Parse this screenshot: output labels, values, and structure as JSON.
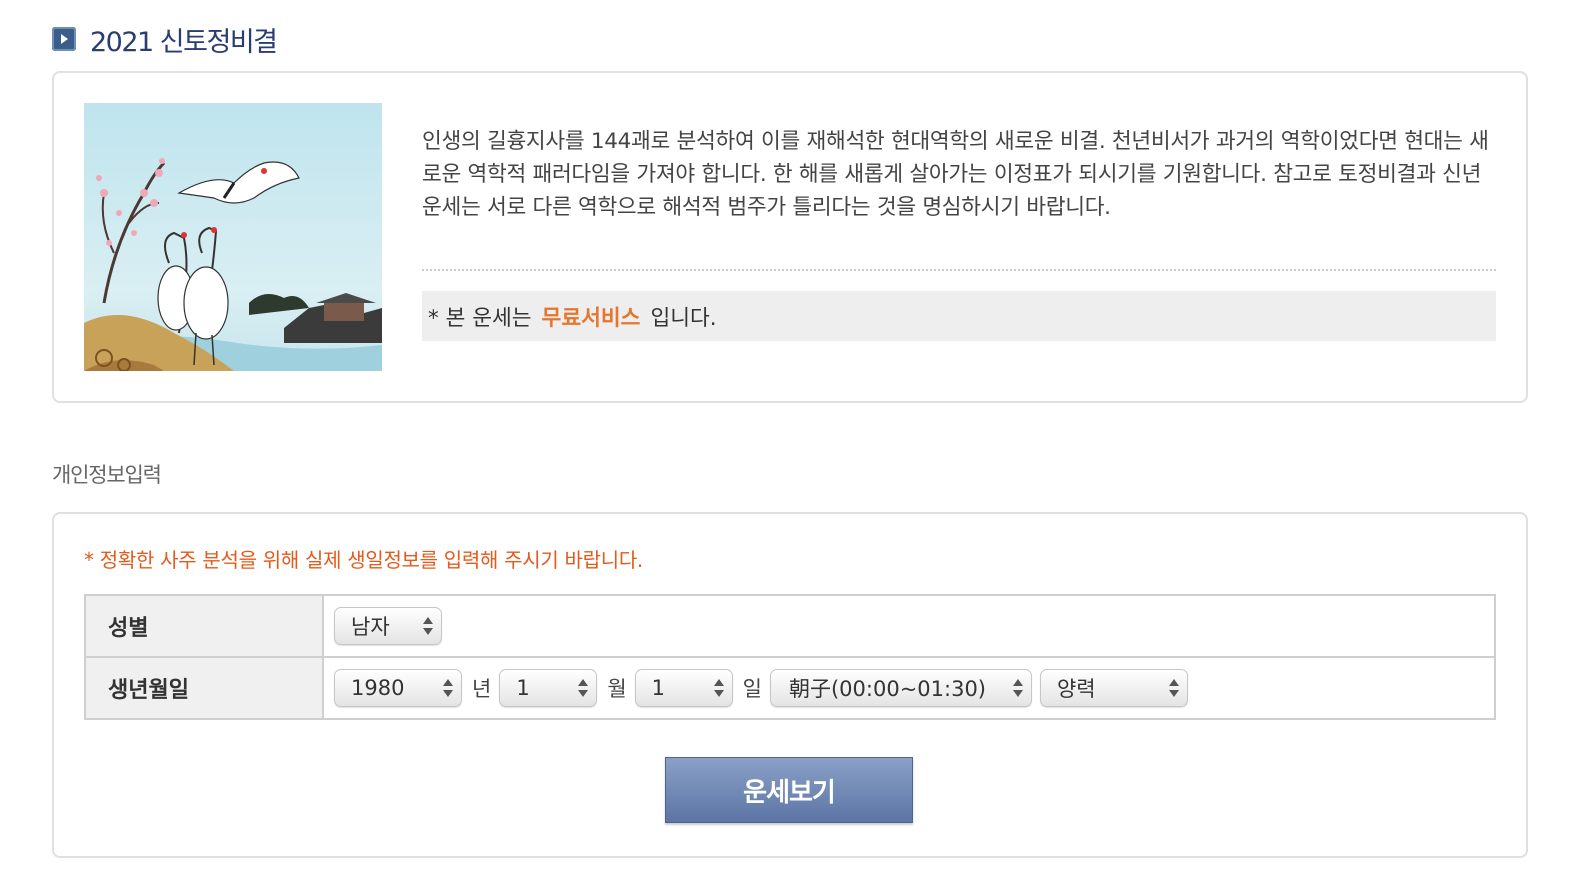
{
  "header": {
    "title": "2021 신토정비결"
  },
  "intro": {
    "image_alt": "cranes-plum-blossom-illustration",
    "description": "인생의 길흉지사를 144괘로 분석하여 이를 재해석한 현대역학의 새로운 비결. 천년비서가 과거의 역학이었다면 현대는 새로운 역학적 패러다임을 가져야 합니다. 한 해를 새롭게 살아가는 이정표가 되시기를 기원합니다. 참고로 토정비결과 신년운세는 서로 다른 역학으로 해석적 범주가 틀리다는 것을 명심하시기 바랍니다.",
    "notice_prefix": "* 본 운세는",
    "notice_highlight": "무료서비스",
    "notice_suffix": "입니다."
  },
  "form": {
    "section_title": "개인정보입력",
    "warning": "* 정확한 사주 분석을 위해 실제 생일정보를 입력해 주시기 바랍니다.",
    "gender_label": "성별",
    "gender_value": "남자",
    "birth_label": "생년월일",
    "year_value": "1980",
    "year_unit": "년",
    "month_value": "1",
    "month_unit": "월",
    "day_value": "1",
    "day_unit": "일",
    "time_value": "朝子(00:00~01:30)",
    "calendar_value": "양력",
    "submit_label": "운세보기"
  },
  "colors": {
    "title": "#2a3d73",
    "accent_orange": "#e6762d",
    "warning_red": "#e45a1c",
    "button": "#6f86b5"
  }
}
